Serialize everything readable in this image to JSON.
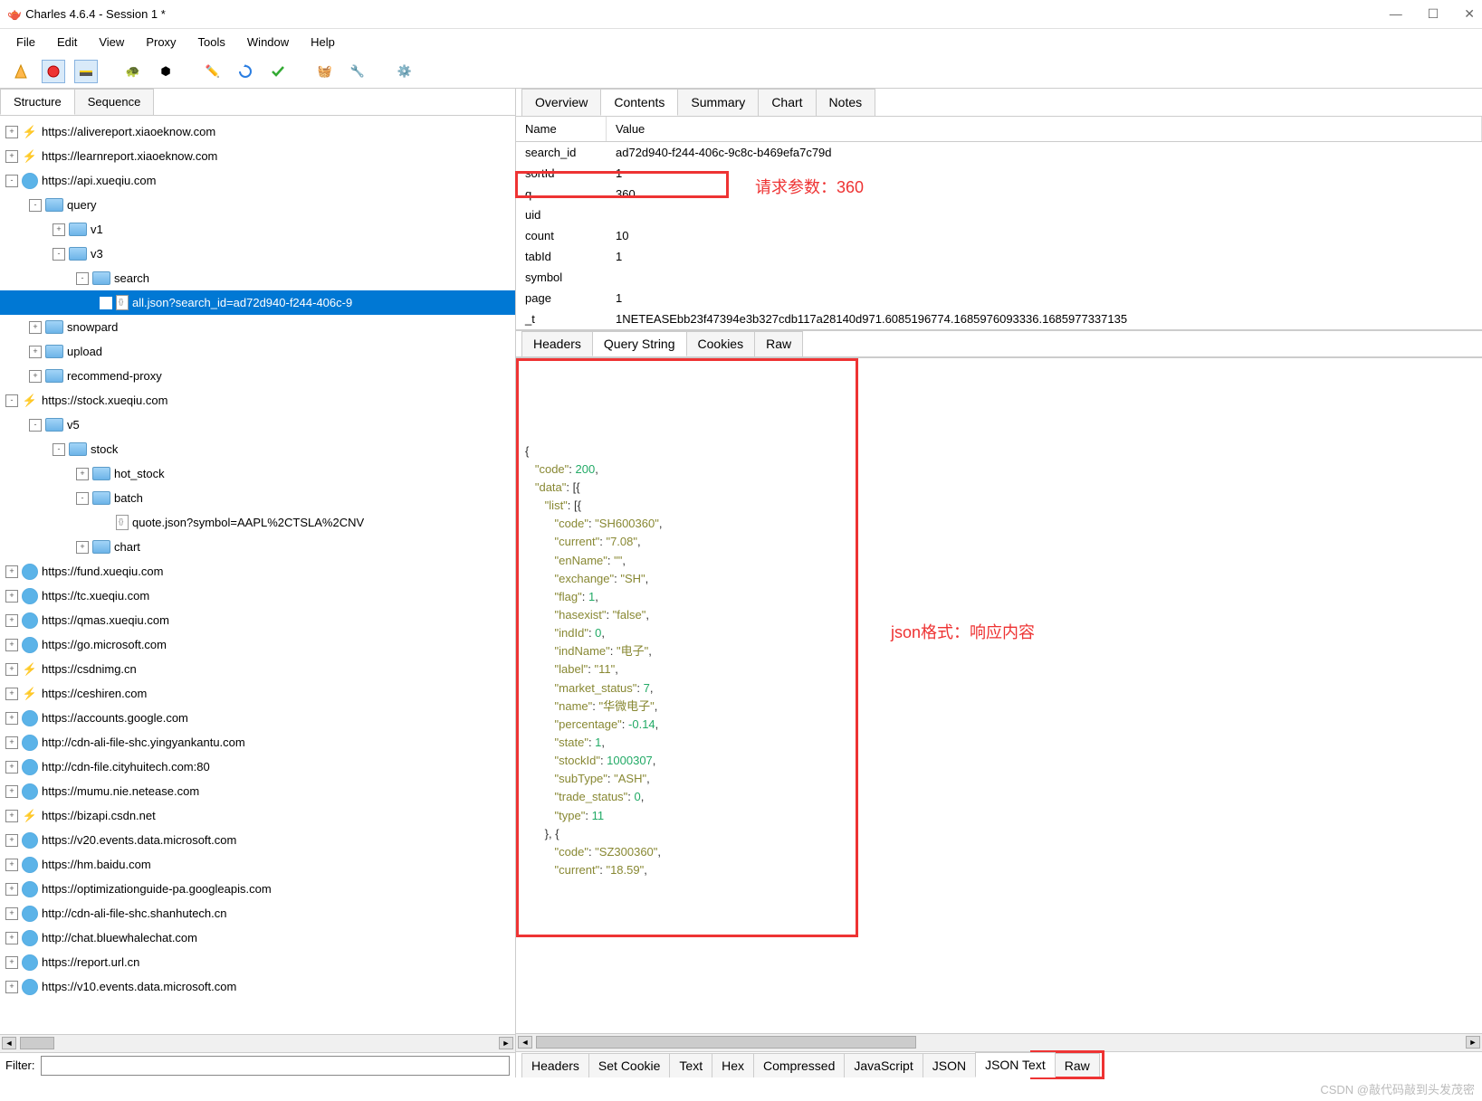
{
  "window": {
    "title": "Charles 4.6.4 - Session 1 *"
  },
  "menus": [
    "File",
    "Edit",
    "View",
    "Proxy",
    "Tools",
    "Window",
    "Help"
  ],
  "left_tabs": [
    {
      "label": "Structure",
      "active": true
    },
    {
      "label": "Sequence",
      "active": false
    }
  ],
  "tree": [
    {
      "d": 0,
      "exp": "+",
      "ico": "bolt",
      "label": "https://alivereport.xiaoeknow.com"
    },
    {
      "d": 0,
      "exp": "+",
      "ico": "bolt",
      "label": "https://learnreport.xiaoeknow.com"
    },
    {
      "d": 0,
      "exp": "-",
      "ico": "globe",
      "label": "https://api.xueqiu.com"
    },
    {
      "d": 1,
      "exp": "-",
      "ico": "folder",
      "label": "query"
    },
    {
      "d": 2,
      "exp": "+",
      "ico": "folder",
      "label": "v1"
    },
    {
      "d": 2,
      "exp": "-",
      "ico": "folder",
      "label": "v3"
    },
    {
      "d": 3,
      "exp": "-",
      "ico": "folder",
      "label": "search"
    },
    {
      "d": 4,
      "exp": " ",
      "ico": "file",
      "label": "all.json?search_id=ad72d940-f244-406c-9",
      "sel": true
    },
    {
      "d": 1,
      "exp": "+",
      "ico": "folder",
      "label": "snowpard"
    },
    {
      "d": 1,
      "exp": "+",
      "ico": "folder",
      "label": "upload"
    },
    {
      "d": 1,
      "exp": "+",
      "ico": "folder",
      "label": "recommend-proxy"
    },
    {
      "d": 0,
      "exp": "-",
      "ico": "bolt",
      "label": "https://stock.xueqiu.com"
    },
    {
      "d": 1,
      "exp": "-",
      "ico": "folder",
      "label": "v5"
    },
    {
      "d": 2,
      "exp": "-",
      "ico": "folder",
      "label": "stock"
    },
    {
      "d": 3,
      "exp": "+",
      "ico": "folder",
      "label": "hot_stock"
    },
    {
      "d": 3,
      "exp": "-",
      "ico": "folder",
      "label": "batch"
    },
    {
      "d": 4,
      "exp": " ",
      "ico": "file",
      "label": "quote.json?symbol=AAPL%2CTSLA%2CNV"
    },
    {
      "d": 3,
      "exp": "+",
      "ico": "folder",
      "label": "chart"
    },
    {
      "d": 0,
      "exp": "+",
      "ico": "globe",
      "label": "https://fund.xueqiu.com"
    },
    {
      "d": 0,
      "exp": "+",
      "ico": "globe",
      "label": "https://tc.xueqiu.com"
    },
    {
      "d": 0,
      "exp": "+",
      "ico": "globe",
      "label": "https://qmas.xueqiu.com"
    },
    {
      "d": 0,
      "exp": "+",
      "ico": "globe",
      "label": "https://go.microsoft.com"
    },
    {
      "d": 0,
      "exp": "+",
      "ico": "bolt",
      "label": "https://csdnimg.cn"
    },
    {
      "d": 0,
      "exp": "+",
      "ico": "bolt",
      "label": "https://ceshiren.com"
    },
    {
      "d": 0,
      "exp": "+",
      "ico": "globe",
      "label": "https://accounts.google.com"
    },
    {
      "d": 0,
      "exp": "+",
      "ico": "globe",
      "label": "http://cdn-ali-file-shc.yingyankantu.com"
    },
    {
      "d": 0,
      "exp": "+",
      "ico": "globe",
      "label": "http://cdn-file.cityhuitech.com:80"
    },
    {
      "d": 0,
      "exp": "+",
      "ico": "globe",
      "label": "https://mumu.nie.netease.com"
    },
    {
      "d": 0,
      "exp": "+",
      "ico": "bolt",
      "label": "https://bizapi.csdn.net"
    },
    {
      "d": 0,
      "exp": "+",
      "ico": "globe",
      "label": "https://v20.events.data.microsoft.com"
    },
    {
      "d": 0,
      "exp": "+",
      "ico": "globe",
      "label": "https://hm.baidu.com"
    },
    {
      "d": 0,
      "exp": "+",
      "ico": "globe",
      "label": "https://optimizationguide-pa.googleapis.com"
    },
    {
      "d": 0,
      "exp": "+",
      "ico": "globe",
      "label": "http://cdn-ali-file-shc.shanhutech.cn"
    },
    {
      "d": 0,
      "exp": "+",
      "ico": "globe",
      "label": "http://chat.bluewhalechat.com"
    },
    {
      "d": 0,
      "exp": "+",
      "ico": "globe",
      "label": "https://report.url.cn"
    },
    {
      "d": 0,
      "exp": "+",
      "ico": "globe",
      "label": "https://v10.events.data.microsoft.com"
    }
  ],
  "filter": {
    "label": "Filter:",
    "value": ""
  },
  "right_tabs": [
    "Overview",
    "Contents",
    "Summary",
    "Chart",
    "Notes"
  ],
  "right_tab_active": "Contents",
  "grid_head": {
    "name": "Name",
    "value": "Value"
  },
  "grid_rows": [
    {
      "n": "search_id",
      "v": "ad72d940-f244-406c-9c8c-b469efa7c79d"
    },
    {
      "n": "sortId",
      "v": "1"
    },
    {
      "n": "q",
      "v": "360",
      "hl": true
    },
    {
      "n": "uid",
      "v": ""
    },
    {
      "n": "count",
      "v": "10"
    },
    {
      "n": "tabId",
      "v": "1"
    },
    {
      "n": "symbol",
      "v": ""
    },
    {
      "n": "page",
      "v": "1"
    },
    {
      "n": "_t",
      "v": "1NETEASEbb23f47394e3b327cdb117a28140d971.6085196774.1685976093336.1685977337135"
    }
  ],
  "annotations": {
    "top": "请求参数：360",
    "bottom": "json格式：响应内容"
  },
  "subtabs_top": [
    "Headers",
    "Query String",
    "Cookies",
    "Raw"
  ],
  "subtabs_top_active": "Query String",
  "subtabs_bottom": [
    "Headers",
    "Set Cookie",
    "Text",
    "Hex",
    "Compressed",
    "JavaScript",
    "JSON",
    "JSON Text",
    "Raw"
  ],
  "subtabs_bottom_active": "JSON Text",
  "json_content": {
    "code": 200,
    "data": [
      {
        "list": [
          {
            "code": "SH600360",
            "current": "7.08",
            "enName": "",
            "exchange": "SH",
            "flag": 1,
            "hasexist": "false",
            "indId": 0,
            "indName": "电子",
            "label": "11",
            "market_status": 7,
            "name": "华微电子",
            "percentage": -0.14,
            "state": 1,
            "stockId": 1000307,
            "subType": "ASH",
            "trade_status": 0,
            "type": 11
          },
          {
            "code": "SZ300360",
            "current": "18.59"
          }
        ]
      }
    ]
  },
  "watermark": "CSDN @敲代码敲到头发茂密"
}
